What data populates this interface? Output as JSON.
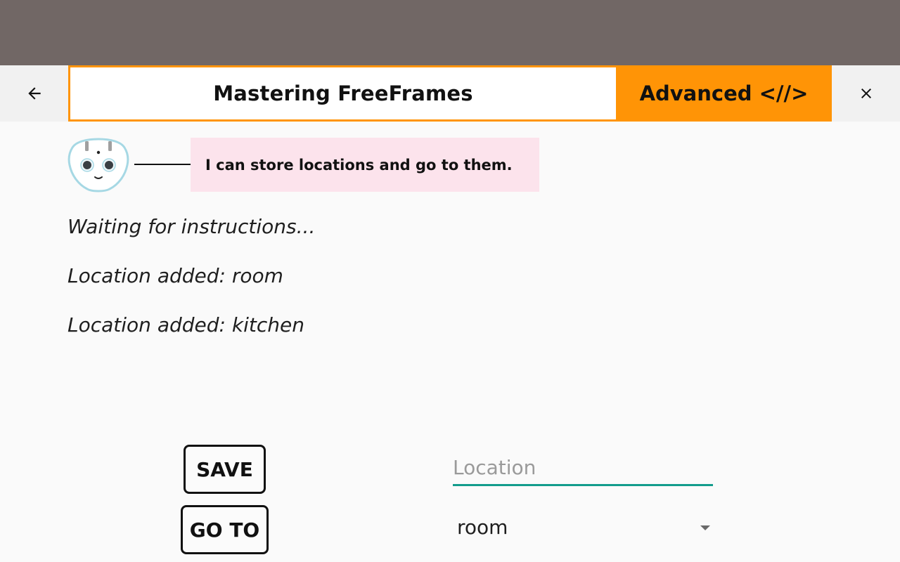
{
  "toolbar": {
    "title": "Mastering FreeFrames",
    "advanced_label": "Advanced <//>",
    "back_icon": "arrow-left-icon",
    "close_icon": "close-icon",
    "accent_color": "#ff9406"
  },
  "robot": {
    "icon": "robot-face-icon",
    "message": "I can store locations and go to them."
  },
  "log": [
    "Waiting for instructions...",
    "Location added: room",
    "Location added: kitchen"
  ],
  "actions": {
    "save_label": "SAVE",
    "goto_label": "GO TO"
  },
  "location_input": {
    "placeholder": "Location",
    "value": ""
  },
  "location_select": {
    "selected": "room",
    "arrow_icon": "dropdown-arrow-icon"
  },
  "colors": {
    "status_bar": "#716765",
    "bubble": "#fce3ec",
    "input_underline": "#139c8c"
  }
}
